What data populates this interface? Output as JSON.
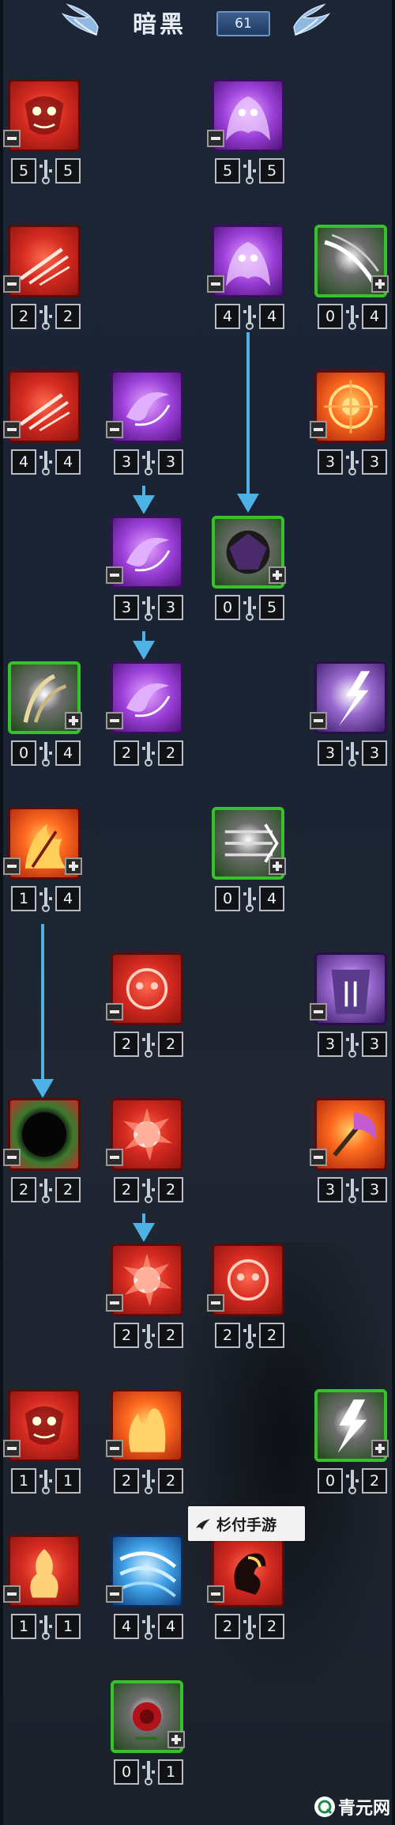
{
  "header": {
    "title": "暗黑",
    "level": "61",
    "left_wing_icon": "blue-wing-icon",
    "right_wing_icon": "blue-wing-icon"
  },
  "skills": [
    {
      "id": "r1c1",
      "icon": "red-demon-face-icon",
      "color": "red",
      "current": "5",
      "max": "5",
      "has_plus": false
    },
    {
      "id": "r1c3",
      "icon": "purple-spirit-icon",
      "color": "purple",
      "current": "5",
      "max": "5",
      "has_plus": false
    },
    {
      "id": "r2c1",
      "icon": "red-claw-slash-icon",
      "color": "red",
      "current": "2",
      "max": "2",
      "has_plus": false
    },
    {
      "id": "r2c3",
      "icon": "purple-spirit-icon",
      "color": "purple",
      "current": "4",
      "max": "4",
      "has_plus": false
    },
    {
      "id": "r2c4",
      "icon": "grey-wing-slash-icon",
      "color": "green",
      "current": "0",
      "max": "4",
      "has_plus": true
    },
    {
      "id": "r3c1",
      "icon": "red-claw-slash-icon",
      "color": "red",
      "current": "4",
      "max": "4",
      "has_plus": false
    },
    {
      "id": "r3c2",
      "icon": "purple-swirl-icon",
      "color": "purple",
      "current": "3",
      "max": "3",
      "has_plus": false
    },
    {
      "id": "r3c4",
      "icon": "fire-sigil-icon",
      "color": "fire",
      "current": "3",
      "max": "3",
      "has_plus": false
    },
    {
      "id": "r4c2",
      "icon": "purple-swirl-icon",
      "color": "purple",
      "current": "3",
      "max": "3",
      "has_plus": false
    },
    {
      "id": "r4c3",
      "icon": "dark-shadow-beast-icon",
      "color": "green",
      "current": "0",
      "max": "5",
      "has_plus": true
    },
    {
      "id": "r5c1",
      "icon": "leaf-claw-icon",
      "color": "green",
      "current": "0",
      "max": "4",
      "has_plus": true
    },
    {
      "id": "r5c2",
      "icon": "purple-swirl-icon",
      "color": "purple",
      "current": "2",
      "max": "2",
      "has_plus": false
    },
    {
      "id": "r5c4",
      "icon": "violet-lightning-icon",
      "color": "violet",
      "current": "3",
      "max": "3",
      "has_plus": false
    },
    {
      "id": "r6c1",
      "icon": "flame-claw-icon",
      "color": "fire",
      "current": "1",
      "max": "4",
      "has_plus": true
    },
    {
      "id": "r6c3",
      "icon": "spike-dash-icon",
      "color": "green",
      "current": "0",
      "max": "4",
      "has_plus": true
    },
    {
      "id": "r7c2",
      "icon": "red-rune-face-icon",
      "color": "red",
      "current": "2",
      "max": "2",
      "has_plus": false
    },
    {
      "id": "r7c4",
      "icon": "purple-armor-icon",
      "color": "violet",
      "current": "3",
      "max": "3",
      "has_plus": false
    },
    {
      "id": "r8c1",
      "icon": "black-hole-orb-icon",
      "color": "dark",
      "current": "2",
      "max": "2",
      "has_plus": false
    },
    {
      "id": "r8c2",
      "icon": "red-explosion-icon",
      "color": "red",
      "current": "2",
      "max": "2",
      "has_plus": false
    },
    {
      "id": "r8c4",
      "icon": "purple-axe-icon",
      "color": "fire",
      "current": "3",
      "max": "3",
      "has_plus": false
    },
    {
      "id": "r9c2",
      "icon": "red-explosion-icon",
      "color": "red",
      "current": "2",
      "max": "2",
      "has_plus": false
    },
    {
      "id": "r9c3",
      "icon": "red-rune-face-icon",
      "color": "red",
      "current": "2",
      "max": "2",
      "has_plus": false
    },
    {
      "id": "r10c1",
      "icon": "red-demon-face-icon",
      "color": "red",
      "current": "1",
      "max": "1",
      "has_plus": false
    },
    {
      "id": "r10c2",
      "icon": "flame-hand-icon",
      "color": "fire",
      "current": "2",
      "max": "2",
      "has_plus": false
    },
    {
      "id": "r10c4",
      "icon": "white-lightning-icon",
      "color": "green",
      "current": "0",
      "max": "2",
      "has_plus": true
    },
    {
      "id": "r11c1",
      "icon": "burning-body-icon",
      "color": "red",
      "current": "1",
      "max": "1",
      "has_plus": false
    },
    {
      "id": "r11c2",
      "icon": "blue-wind-slash-icon",
      "color": "sky",
      "current": "4",
      "max": "4",
      "has_plus": false
    },
    {
      "id": "r11c3",
      "icon": "flame-dragon-icon",
      "color": "red",
      "current": "2",
      "max": "2",
      "has_plus": false
    },
    {
      "id": "r12c2",
      "icon": "red-rose-icon",
      "color": "green",
      "current": "0",
      "max": "1",
      "has_plus": true
    }
  ],
  "watermark": {
    "text": "杉付手游",
    "icon": "bird-logo-icon"
  },
  "corner_logo": {
    "text": "青元网",
    "icon": "q-logo-icon"
  }
}
